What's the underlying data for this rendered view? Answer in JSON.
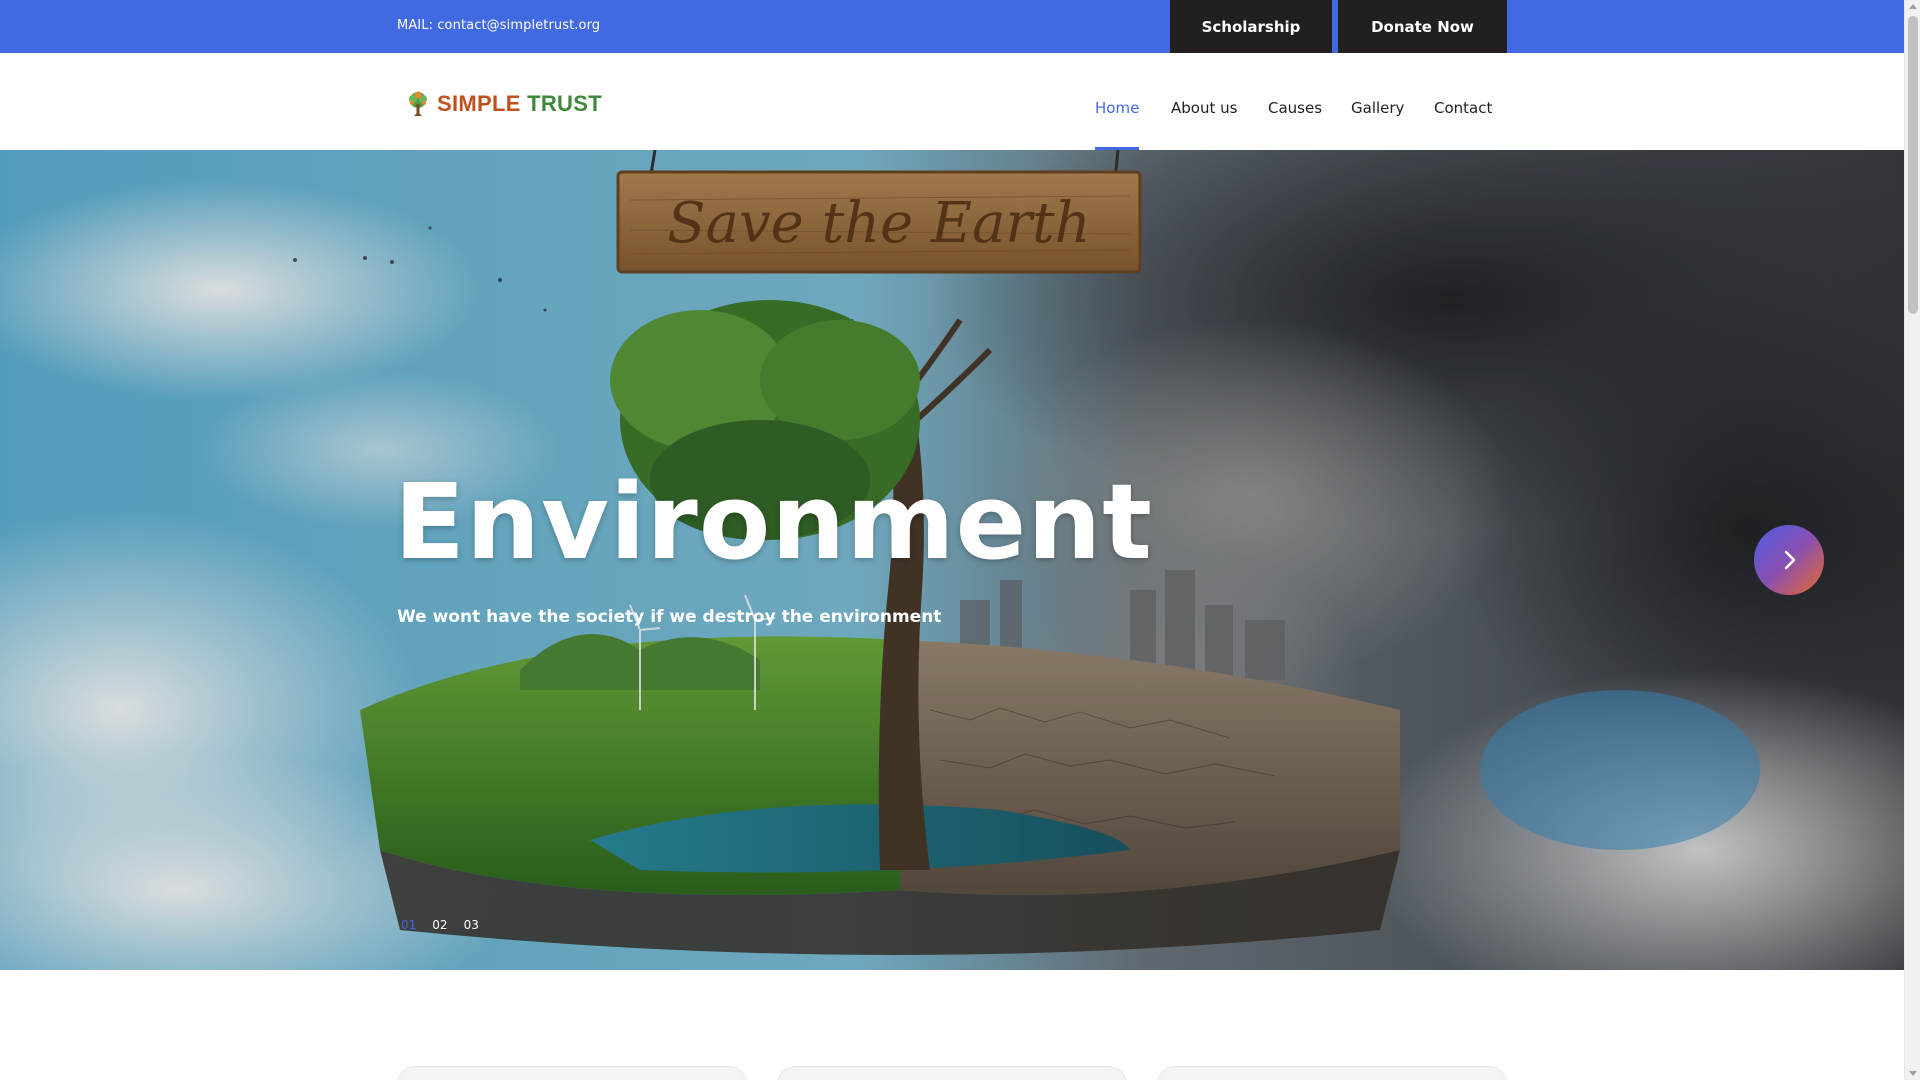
{
  "topbar": {
    "mail": "MAIL: contact@simpletrust.org",
    "scholarship_label": "Scholarship",
    "donate_label": "Donate Now",
    "bg_color": "#4169e1",
    "button_color": "#231f1e"
  },
  "nav": {
    "logo_simple": "SIMPLE",
    "logo_trust": "TRUST",
    "logo_icon": "tree-icon",
    "items": [
      {
        "label": "Home",
        "active": true
      },
      {
        "label": "About us",
        "active": false
      },
      {
        "label": "Causes",
        "active": false
      },
      {
        "label": "Gallery",
        "active": false
      },
      {
        "label": "Contact",
        "active": false
      }
    ],
    "active_color": "#4169e1"
  },
  "hero": {
    "sign_text": "Save the Earth",
    "title": "Environment",
    "subtitle": "We wont have the society if we destroy the environment",
    "next_icon": "chevron-right-icon",
    "slides": [
      "01",
      "02",
      "03"
    ],
    "active_slide": 0
  },
  "cards": {
    "count": 3
  }
}
